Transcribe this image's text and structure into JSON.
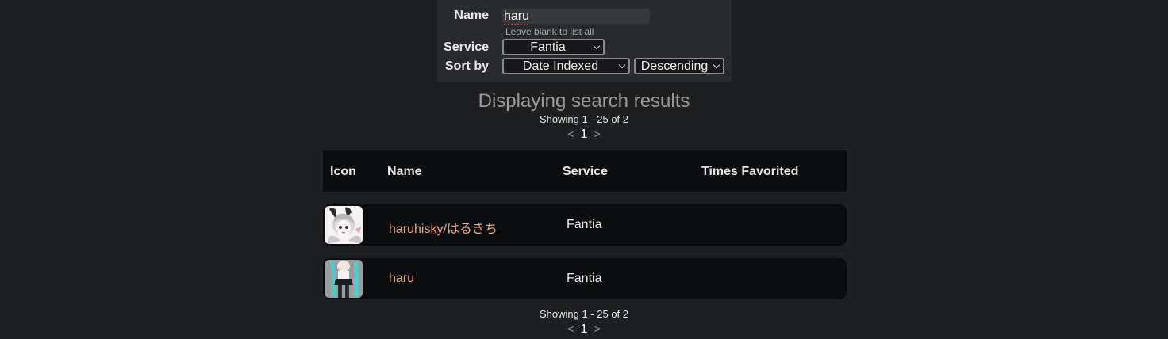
{
  "search": {
    "name_label": "Name",
    "name_value": "haru",
    "hint": "Leave blank to list all",
    "service_label": "Service",
    "service_selected": "Fantia",
    "sort_label": "Sort by",
    "sort_selected": "Date Indexed",
    "order_selected": "Descending"
  },
  "results": {
    "title": "Displaying search results",
    "showing_text": "Showing 1 - 25 of 2",
    "pagination": {
      "prev": "<",
      "current_page": "1",
      "next": ">"
    }
  },
  "table": {
    "headers": {
      "icon": "Icon",
      "name": "Name",
      "service": "Service",
      "times_favorited": "Times Favorited"
    },
    "rows": [
      {
        "name": "haruhisky/はるきち",
        "service": "Fantia",
        "times_favorited": "",
        "icon": "avatar-anime-girl-white"
      },
      {
        "name": "haru",
        "service": "Fantia",
        "times_favorited": "",
        "icon": "avatar-anime-girl-teal-hair"
      }
    ]
  },
  "colors": {
    "background": "#1d1f20",
    "form_background": "#282a2e",
    "table_background": "#0b0c0d",
    "link_color": "#f0a683",
    "title_color": "#9c9a96"
  }
}
